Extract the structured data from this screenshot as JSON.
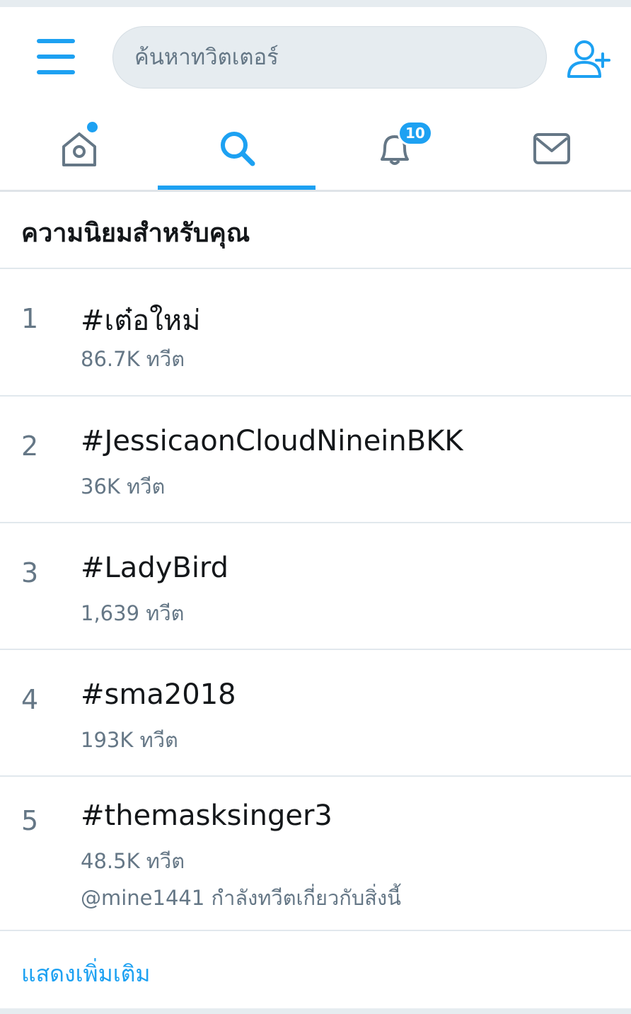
{
  "header": {
    "search_placeholder": "ค้นหาทวิตเตอร์",
    "menu_icon": "hamburger-menu-icon",
    "add_user_icon": "add-user-icon"
  },
  "tabs": [
    {
      "name": "home",
      "icon": "home-icon",
      "has_dot": true
    },
    {
      "name": "search",
      "icon": "search-icon",
      "active": true
    },
    {
      "name": "notifications",
      "icon": "bell-icon",
      "badge": "10"
    },
    {
      "name": "messages",
      "icon": "mail-icon"
    }
  ],
  "section": {
    "title": "ความนิยมสำหรับคุณ"
  },
  "trends": [
    {
      "rank": "1",
      "name": "#เต๋อใหม่",
      "count": "86.7K ทวีต"
    },
    {
      "rank": "2",
      "name": "#JessicaonCloudNineinBKK",
      "count": "36K ทวีต"
    },
    {
      "rank": "3",
      "name": "#LadyBird",
      "count": "1,639 ทวีต"
    },
    {
      "rank": "4",
      "name": "#sma2018",
      "count": "193K ทวีต"
    },
    {
      "rank": "5",
      "name": "#themasksinger3",
      "count": "48.5K ทวีต",
      "context": "@mine1441 กำลังทวีตเกี่ยวกับสิ่งนี้"
    }
  ],
  "footer": {
    "show_more": "แสดงเพิ่มเติม"
  },
  "colors": {
    "accent": "#1da1f2",
    "secondary_text": "#657786",
    "primary_text": "#14171a",
    "search_bg": "#e6ecf0"
  }
}
